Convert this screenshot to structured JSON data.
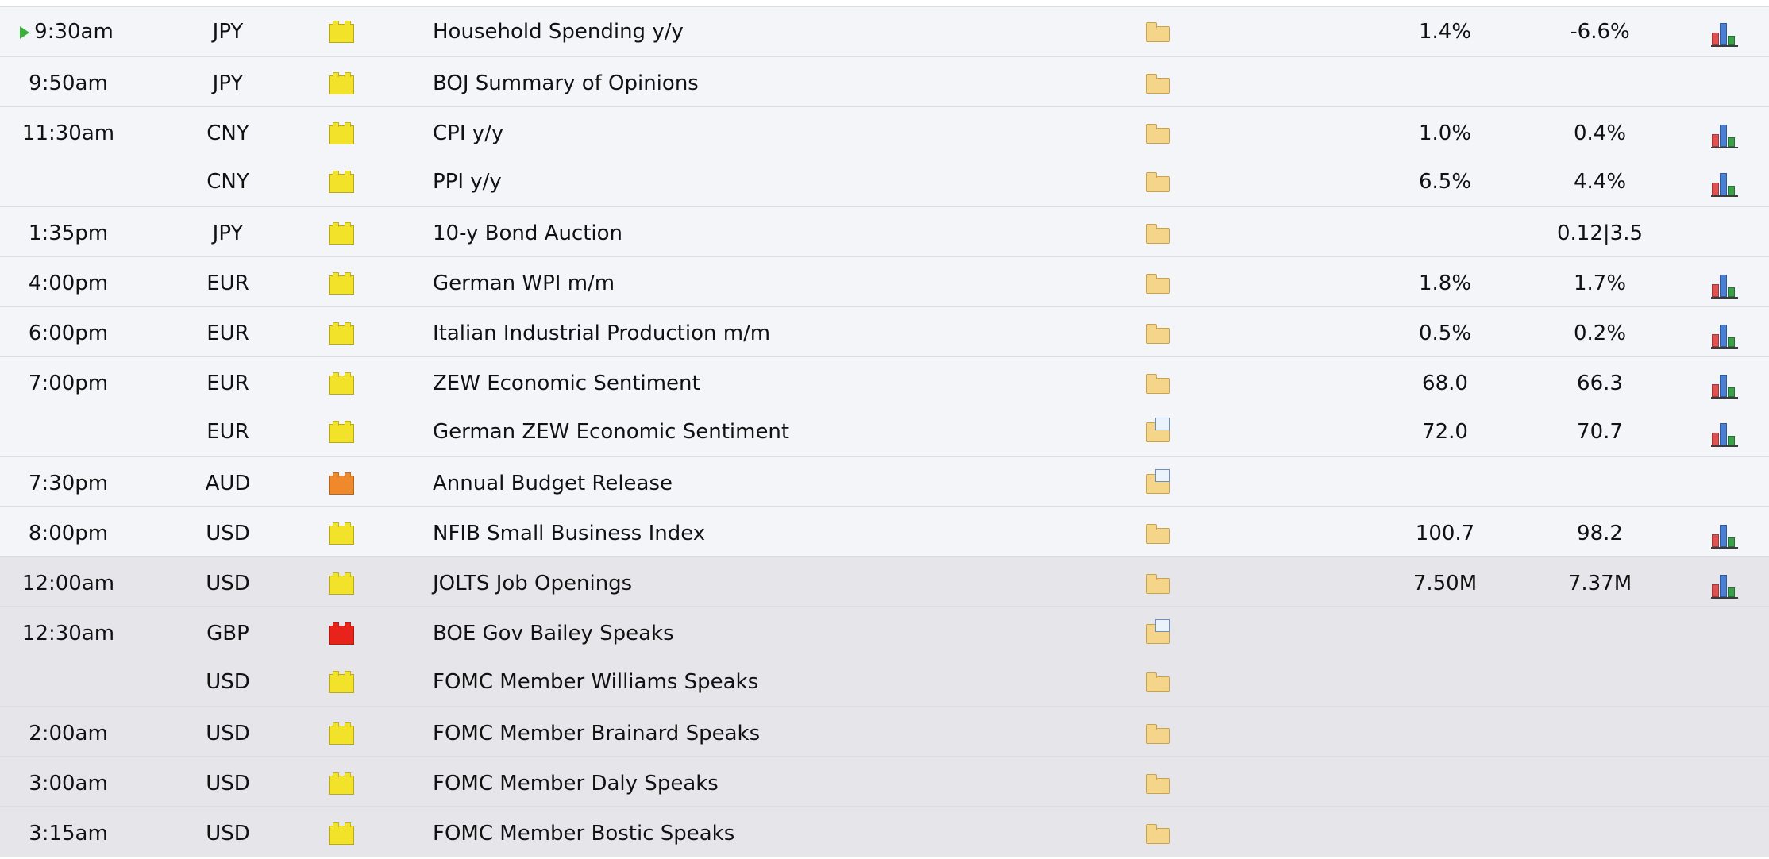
{
  "colors": {
    "impact_low": "#f2e22a",
    "impact_medium": "#f0882c",
    "impact_high": "#e8231b"
  },
  "rows": [
    {
      "time": "9:30am",
      "currency": "JPY",
      "impact": "low",
      "event": "Household Spending y/y",
      "detail_icon": "folder-icon",
      "actual": "1.4%",
      "forecast": "-6.6%",
      "graph": true,
      "current": true
    },
    {
      "time": "9:50am",
      "currency": "JPY",
      "impact": "low",
      "event": "BOJ Summary of Opinions",
      "detail_icon": "folder-icon",
      "actual": "",
      "forecast": "",
      "graph": false
    },
    {
      "time": "11:30am",
      "currency": "CNY",
      "impact": "low",
      "event": "CPI y/y",
      "detail_icon": "folder-icon",
      "actual": "1.0%",
      "forecast": "0.4%",
      "graph": true
    },
    {
      "time": "",
      "currency": "CNY",
      "impact": "low",
      "event": "PPI y/y",
      "detail_icon": "folder-icon",
      "actual": "6.5%",
      "forecast": "4.4%",
      "graph": true
    },
    {
      "time": "1:35pm",
      "currency": "JPY",
      "impact": "low",
      "event": "10-y Bond Auction",
      "detail_icon": "folder-icon",
      "actual": "",
      "forecast": "0.12|3.5",
      "graph": false
    },
    {
      "time": "4:00pm",
      "currency": "EUR",
      "impact": "low",
      "event": "German WPI m/m",
      "detail_icon": "folder-icon",
      "actual": "1.8%",
      "forecast": "1.7%",
      "graph": true
    },
    {
      "time": "6:00pm",
      "currency": "EUR",
      "impact": "low",
      "event": "Italian Industrial Production m/m",
      "detail_icon": "folder-icon",
      "actual": "0.5%",
      "forecast": "0.2%",
      "graph": true
    },
    {
      "time": "7:00pm",
      "currency": "EUR",
      "impact": "low",
      "event": "ZEW Economic Sentiment",
      "detail_icon": "folder-icon",
      "actual": "68.0",
      "forecast": "66.3",
      "graph": true
    },
    {
      "time": "",
      "currency": "EUR",
      "impact": "low",
      "event": "German ZEW Economic Sentiment",
      "detail_icon": "folder-document-icon",
      "actual": "72.0",
      "forecast": "70.7",
      "graph": true
    },
    {
      "time": "7:30pm",
      "currency": "AUD",
      "impact": "medium",
      "event": "Annual Budget Release",
      "detail_icon": "folder-document-icon",
      "actual": "",
      "forecast": "",
      "graph": false
    },
    {
      "time": "8:00pm",
      "currency": "USD",
      "impact": "low",
      "event": "NFIB Small Business Index",
      "detail_icon": "folder-icon",
      "actual": "100.7",
      "forecast": "98.2",
      "graph": true
    },
    {
      "time": "12:00am",
      "currency": "USD",
      "impact": "low",
      "event": "JOLTS Job Openings",
      "detail_icon": "folder-icon",
      "actual": "7.50M",
      "forecast": "7.37M",
      "graph": true
    },
    {
      "time": "12:30am",
      "currency": "GBP",
      "impact": "high",
      "event": "BOE Gov Bailey Speaks",
      "detail_icon": "folder-document-icon",
      "actual": "",
      "forecast": "",
      "graph": false
    },
    {
      "time": "",
      "currency": "USD",
      "impact": "low",
      "event": "FOMC Member Williams Speaks",
      "detail_icon": "folder-icon",
      "actual": "",
      "forecast": "",
      "graph": false
    },
    {
      "time": "2:00am",
      "currency": "USD",
      "impact": "low",
      "event": "FOMC Member Brainard Speaks",
      "detail_icon": "folder-icon",
      "actual": "",
      "forecast": "",
      "graph": false
    },
    {
      "time": "3:00am",
      "currency": "USD",
      "impact": "low",
      "event": "FOMC Member Daly Speaks",
      "detail_icon": "folder-icon",
      "actual": "",
      "forecast": "",
      "graph": false
    },
    {
      "time": "3:15am",
      "currency": "USD",
      "impact": "low",
      "event": "FOMC Member Bostic Speaks",
      "detail_icon": "folder-icon",
      "actual": "",
      "forecast": "",
      "graph": false
    }
  ]
}
